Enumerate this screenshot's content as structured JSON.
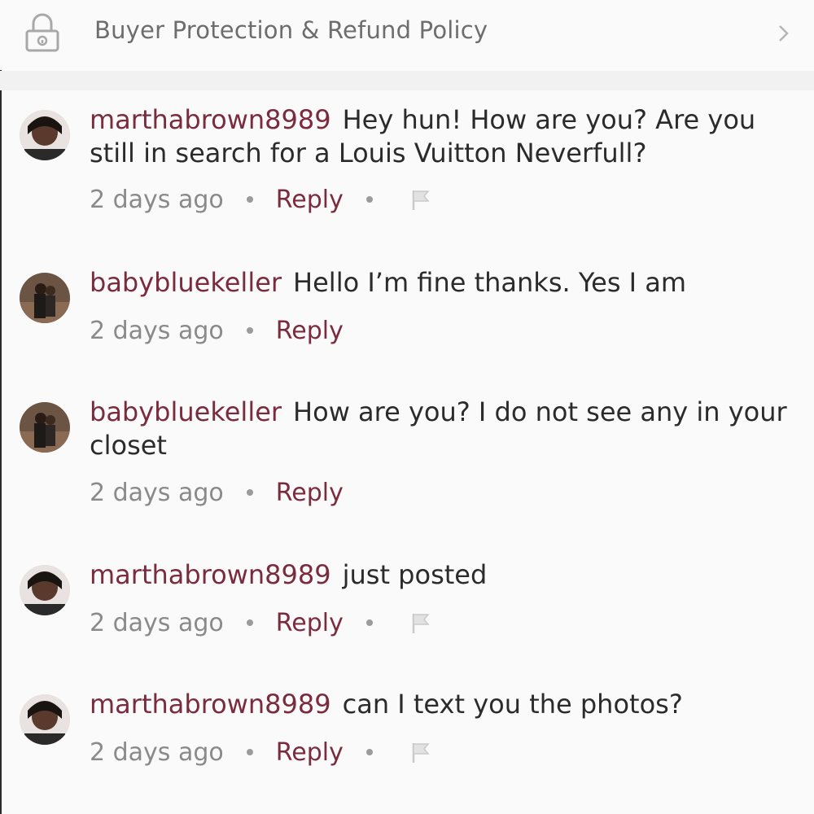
{
  "policy": {
    "label": "Buyer Protection & Refund Policy",
    "icon": "lock-icon",
    "chevron": "chevron-right-icon"
  },
  "colors": {
    "username": "#7a2c3e",
    "reply": "#7a2c3e",
    "meta": "#8a8a8a",
    "text": "#2b2b2b"
  },
  "comments": [
    {
      "username": "marthabrown8989",
      "text": "Hey hun! How are you? Are you still in search for a Louis Vuitton Neverfull?",
      "time": "2 days ago",
      "reply": "Reply",
      "has_flag": true
    },
    {
      "username": "babybluekeller",
      "text": "Hello I’m fine thanks. Yes I am",
      "time": "2 days ago",
      "reply": "Reply",
      "has_flag": false
    },
    {
      "username": "babybluekeller",
      "text": "How are you? I do not see any in your closet",
      "time": "2 days ago",
      "reply": "Reply",
      "has_flag": false
    },
    {
      "username": "marthabrown8989",
      "text": "just posted",
      "time": "2 days ago",
      "reply": "Reply",
      "has_flag": true
    },
    {
      "username": "marthabrown8989",
      "text": "can I text you the photos?",
      "time": "2 days ago",
      "reply": "Reply",
      "has_flag": true
    }
  ]
}
